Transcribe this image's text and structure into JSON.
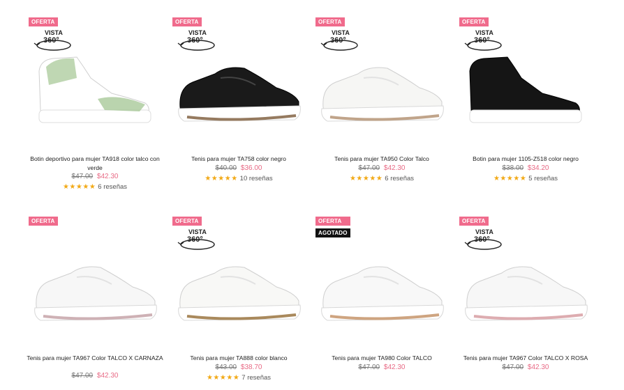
{
  "products": [
    {
      "badge": "OFERTA",
      "badge2": "",
      "vista": "VISTA",
      "deg": "360°",
      "title": "Botin deportivo para mujer TA918 color talco con verde",
      "old_price": "$47.00",
      "new_price": "$42.30",
      "stars": "★★★★★",
      "reviews": "6 reseñas",
      "color": "#ffffff",
      "accent": "#a9c99a"
    },
    {
      "badge": "OFERTA",
      "badge2": "",
      "vista": "VISTA",
      "deg": "360°",
      "title": "Tenis para mujer TA758 color negro",
      "old_price": "$40.00",
      "new_price": "$36.00",
      "stars": "★★★★★",
      "reviews": "10 reseñas",
      "color": "#1a1a1a",
      "accent": "#8a6b4e"
    },
    {
      "badge": "OFERTA",
      "badge2": "",
      "vista": "VISTA",
      "deg": "360°",
      "title": "Tenis para mujer TA950 Color Talco",
      "old_price": "$47.00",
      "new_price": "$42.30",
      "stars": "★★★★★",
      "reviews": "6 reseñas",
      "color": "#f6f6f4",
      "accent": "#b99a7d"
    },
    {
      "badge": "OFERTA",
      "badge2": "",
      "vista": "VISTA",
      "deg": "360°",
      "title": "Botin para mujer 1105-Z518 color negro",
      "old_price": "$38.00",
      "new_price": "$34.20",
      "stars": "★★★★★",
      "reviews": "5 reseñas",
      "color": "#151515",
      "accent": "#ffffff"
    },
    {
      "badge": "OFERTA",
      "badge2": "",
      "vista": "",
      "deg": "",
      "title": "Tenis para mujer TA967 Color TALCO X CARNAZA",
      "old_price": "$47.00",
      "new_price": "$42.30",
      "stars": "",
      "reviews": "",
      "color": "#f7f7f7",
      "accent": "#c9a9ad"
    },
    {
      "badge": "OFERTA",
      "badge2": "",
      "vista": "VISTA",
      "deg": "360°",
      "title": "Tenis para mujer TA888 color blanco",
      "old_price": "$43.00",
      "new_price": "$38.70",
      "stars": "★★★★★",
      "reviews": "7 reseñas",
      "color": "#f8f8f6",
      "accent": "#a07c4a"
    },
    {
      "badge": "OFERTA",
      "badge2": "AGOTADO",
      "vista": "",
      "deg": "",
      "title": "Tenis para mujer TA980 Color TALCO",
      "old_price": "$47.00",
      "new_price": "$42.30",
      "stars": "",
      "reviews": "",
      "color": "#f8f8f8",
      "accent": "#c99a72"
    },
    {
      "badge": "OFERTA",
      "badge2": "",
      "vista": "VISTA",
      "deg": "360°",
      "title": "Tenis para mujer TA967 Color TALCO X ROSA",
      "old_price": "$47.00",
      "new_price": "$42.30",
      "stars": "",
      "reviews": "",
      "color": "#f7f7f7",
      "accent": "#d9a3a7"
    }
  ]
}
